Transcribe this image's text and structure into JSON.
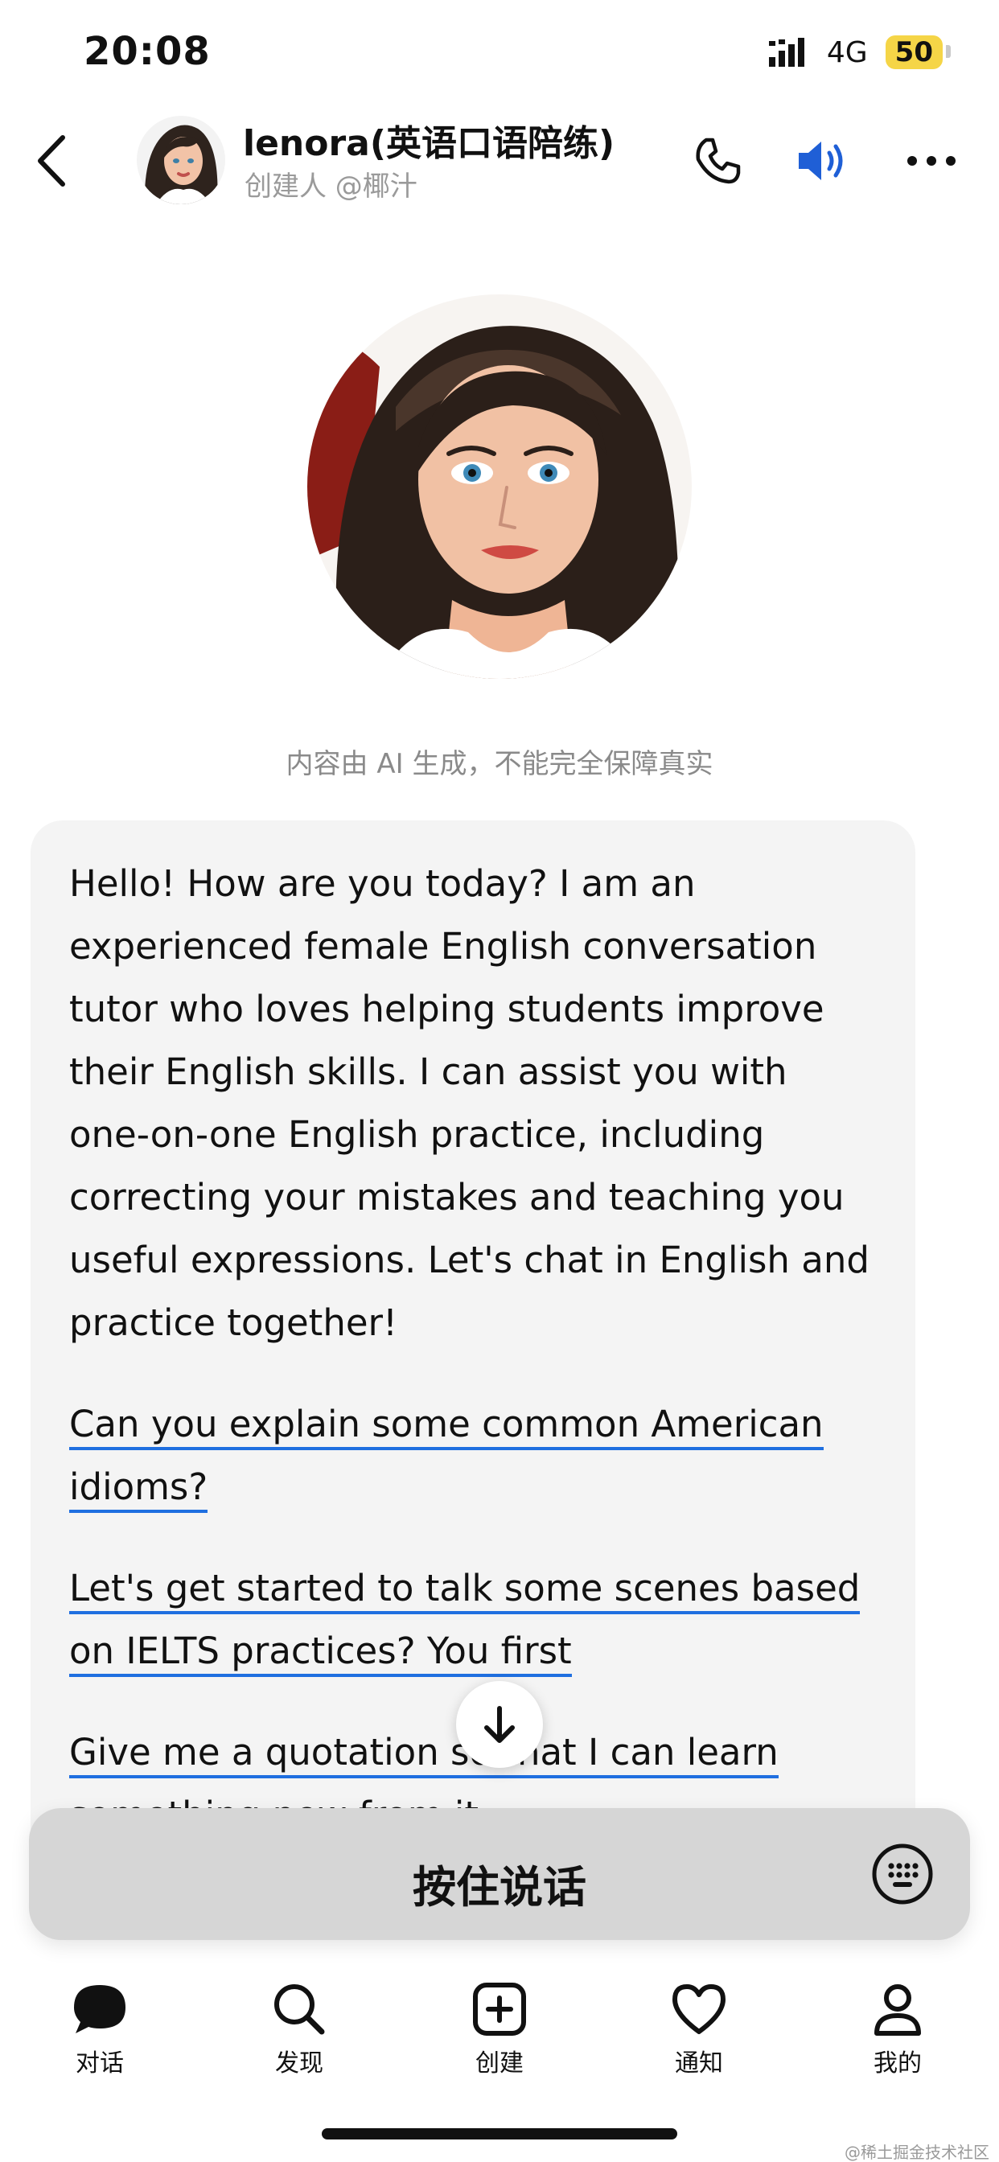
{
  "status_bar": {
    "time": "20:08",
    "network": "4G",
    "battery": "50"
  },
  "header": {
    "title": "lenora(英语口语陪练)",
    "creator": "创建人 @椰汁"
  },
  "disclaimer": "内容由 AI 生成，不能完全保障真实",
  "message": {
    "text": "Hello! How are you today? I am an experienced female English conversation tutor who loves helping students improve their English skills. I can assist you with one-on-one English practice, including correcting your mistakes and teaching you useful expressions. Let's chat in English and practice together!",
    "suggestions": [
      "Can you explain some common American idioms?",
      "Let's get started to talk some scenes based on IELTS practices? You first",
      "Give me a quotation so that I can learn something new from it"
    ]
  },
  "input_bar": {
    "hold_to_talk": "按住说话"
  },
  "tabs": [
    {
      "label": "对话",
      "icon": "chat-bubble-icon"
    },
    {
      "label": "发现",
      "icon": "search-icon"
    },
    {
      "label": "创建",
      "icon": "add-square-icon"
    },
    {
      "label": "通知",
      "icon": "heart-icon"
    },
    {
      "label": "我的",
      "icon": "person-icon"
    }
  ],
  "watermark": "@稀土掘金技术社区",
  "colors": {
    "accent": "#1f6fe0",
    "card_bg": "#f4f4f4",
    "battery": "#f5d547"
  }
}
